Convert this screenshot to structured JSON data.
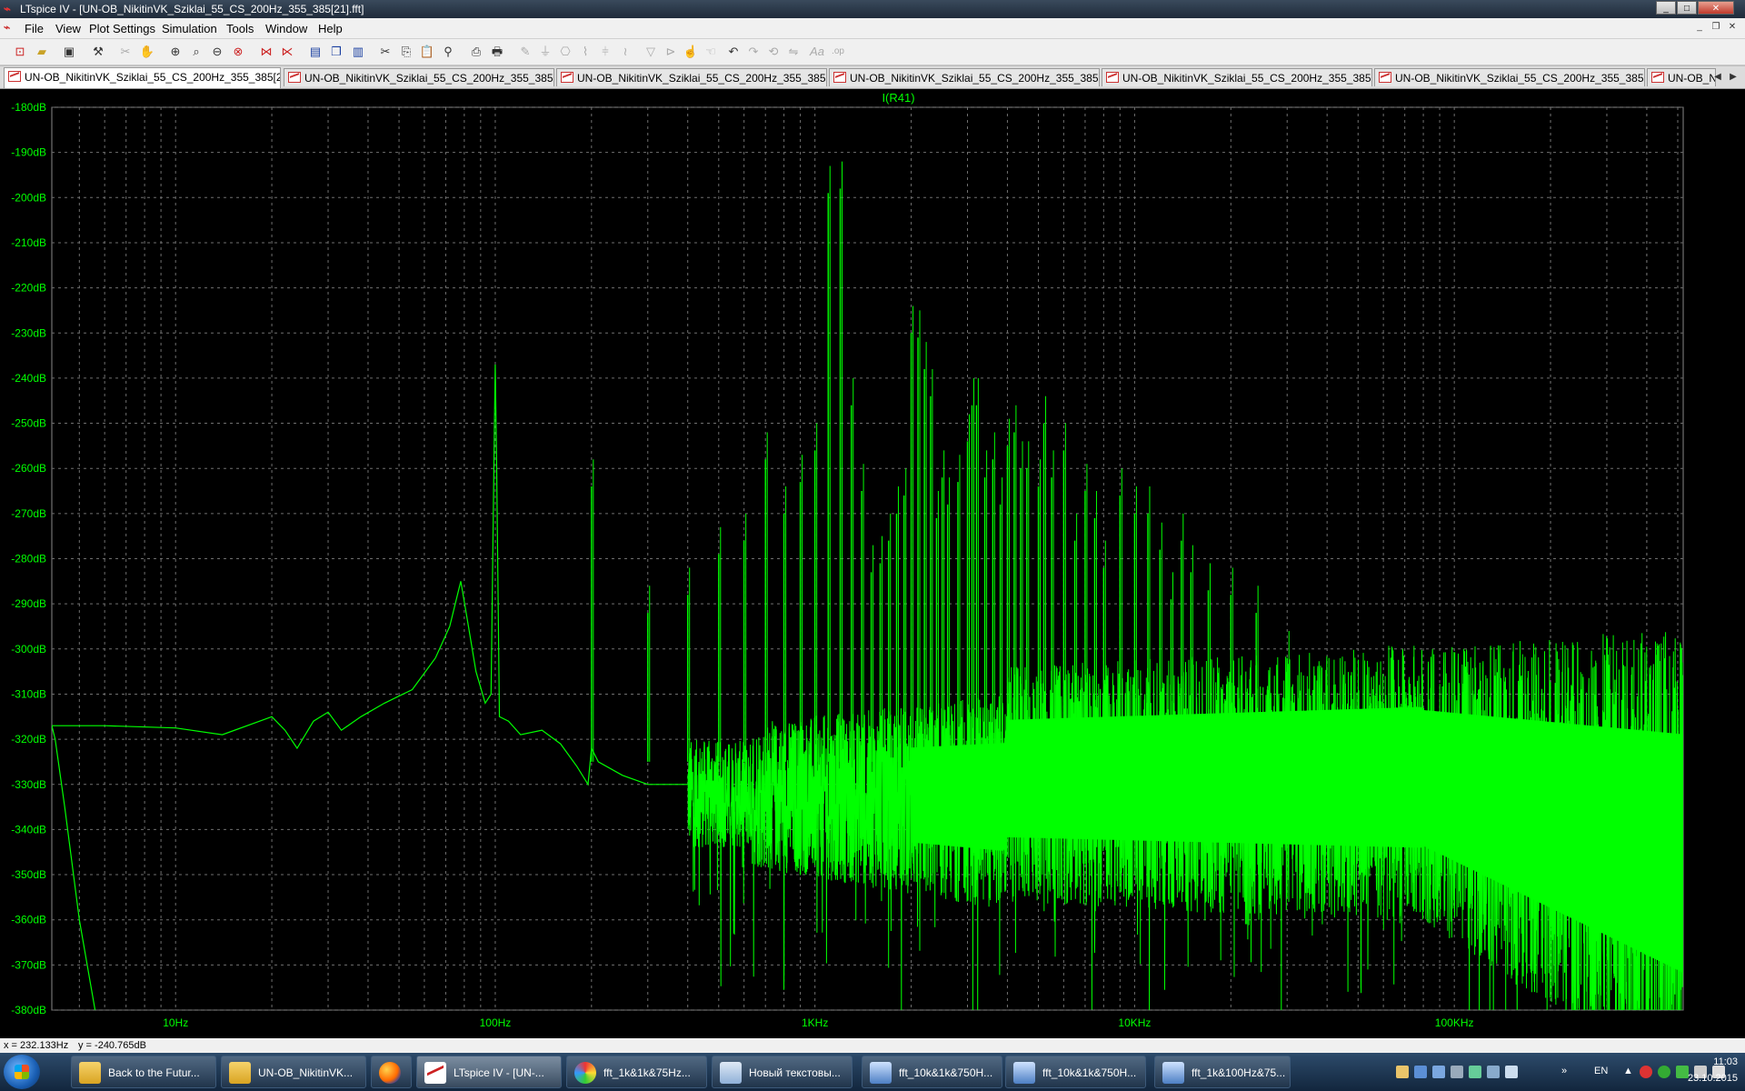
{
  "window": {
    "title": "LTspice IV - [UN-OB_NikitinVK_Sziklai_55_CS_200Hz_355_385[21].fft]",
    "controls": [
      "_",
      "□",
      "✕"
    ]
  },
  "menu": {
    "items": [
      "File",
      "View",
      "Plot Settings",
      "Simulation",
      "Tools",
      "Window",
      "Help"
    ]
  },
  "toolbar": {
    "buttons": [
      "new-schematic",
      "open",
      "save",
      "control-panel",
      "cut-dim",
      "pan-dim",
      "zoom-in",
      "zoom-area",
      "zoom-out",
      "zoom-fit",
      "autorange",
      "mark-unconnected",
      "tile-horizontal",
      "cascade",
      "tile-vertical",
      "cut",
      "copy",
      "paste",
      "find",
      "print-preview",
      "print",
      "wire",
      "ground",
      "label",
      "resistor",
      "capacitor",
      "inductor",
      "diode",
      "component",
      "move",
      "drag",
      "undo",
      "redo",
      "rotate",
      "mirror",
      "text",
      "spice-directive"
    ]
  },
  "tabs": [
    {
      "label": "UN-OB_NikitinVK_Sziklai_55_CS_200Hz_355_385[21].fft",
      "active": true
    },
    {
      "label": "UN-OB_NikitinVK_Sziklai_55_CS_200Hz_355_385[2].fft",
      "active": false
    },
    {
      "label": "UN-OB_NikitinVK_Sziklai_55_CS_200Hz_355_385[3].fft",
      "active": false
    },
    {
      "label": "UN-OB_NikitinVK_Sziklai_55_CS_200Hz_355_385[4].fft",
      "active": false
    },
    {
      "label": "UN-OB_NikitinVK_Sziklai_55_CS_200Hz_355_385[5].fft",
      "active": false
    },
    {
      "label": "UN-OB_NikitinVK_Sziklai_55_CS_200Hz_355_385[6].fft",
      "active": false
    },
    {
      "label": "UN-OB_N",
      "active": false
    }
  ],
  "chart_data": {
    "type": "line",
    "title": "I(R41)",
    "series": [
      {
        "name": "I(R41)",
        "color": "#00ff00"
      }
    ],
    "xscale": "log",
    "xlim": [
      4.1,
      520000
    ],
    "ylim": [
      -380,
      -180
    ],
    "xlabel": "",
    "ylabel": "",
    "xticks": [
      {
        "value": 10,
        "label": "10Hz"
      },
      {
        "value": 100,
        "label": "100Hz"
      },
      {
        "value": 1000,
        "label": "1KHz"
      },
      {
        "value": 10000,
        "label": "10KHz"
      },
      {
        "value": 100000,
        "label": "100KHz"
      }
    ],
    "yticks": [
      {
        "value": -180,
        "label": "-180dB"
      },
      {
        "value": -190,
        "label": "-190dB"
      },
      {
        "value": -200,
        "label": "-200dB"
      },
      {
        "value": -210,
        "label": "-210dB"
      },
      {
        "value": -220,
        "label": "-220dB"
      },
      {
        "value": -230,
        "label": "-230dB"
      },
      {
        "value": -240,
        "label": "-240dB"
      },
      {
        "value": -250,
        "label": "-250dB"
      },
      {
        "value": -260,
        "label": "-260dB"
      },
      {
        "value": -270,
        "label": "-270dB"
      },
      {
        "value": -280,
        "label": "-280dB"
      },
      {
        "value": -290,
        "label": "-290dB"
      },
      {
        "value": -300,
        "label": "-300dB"
      },
      {
        "value": -310,
        "label": "-310dB"
      },
      {
        "value": -320,
        "label": "-320dB"
      },
      {
        "value": -330,
        "label": "-330dB"
      },
      {
        "value": -340,
        "label": "-340dB"
      },
      {
        "value": -350,
        "label": "-350dB"
      },
      {
        "value": -360,
        "label": "-360dB"
      },
      {
        "value": -370,
        "label": "-370dB"
      },
      {
        "value": -380,
        "label": "-380dB"
      }
    ],
    "grid": true,
    "background": "#000000",
    "low_freq_trace": [
      [
        4.1,
        -317
      ],
      [
        4.2,
        -320
      ],
      [
        4.5,
        -335
      ],
      [
        5.0,
        -360
      ],
      [
        5.6,
        -380
      ]
    ],
    "main_trace": [
      [
        4.1,
        -317
      ],
      [
        6,
        -317
      ],
      [
        10,
        -317.5
      ],
      [
        14,
        -319
      ],
      [
        20,
        -315
      ],
      [
        22,
        -318
      ],
      [
        24,
        -322
      ],
      [
        27,
        -316
      ],
      [
        30,
        -314
      ],
      [
        33,
        -318
      ],
      [
        38,
        -315
      ],
      [
        45,
        -312
      ],
      [
        55,
        -309
      ],
      [
        65,
        -302
      ],
      [
        72,
        -295
      ],
      [
        78,
        -285
      ],
      [
        82,
        -294
      ],
      [
        87,
        -305
      ],
      [
        93,
        -312
      ],
      [
        97,
        -310
      ],
      [
        99,
        -260
      ],
      [
        100,
        -237
      ],
      [
        101,
        -260
      ],
      [
        103,
        -315
      ],
      [
        110,
        -316
      ],
      [
        120,
        -319
      ],
      [
        140,
        -318
      ],
      [
        160,
        -321
      ],
      [
        180,
        -326
      ],
      [
        195,
        -330
      ],
      [
        200,
        -322
      ],
      [
        210,
        -325
      ],
      [
        250,
        -328
      ],
      [
        300,
        -330
      ],
      [
        400,
        -330
      ]
    ],
    "harmonics": [
      [
        200,
        -264
      ],
      [
        300,
        -292
      ],
      [
        400,
        -288
      ],
      [
        500,
        -279
      ],
      [
        600,
        -276
      ],
      [
        700,
        -258
      ],
      [
        800,
        -270
      ],
      [
        900,
        -263
      ],
      [
        1000,
        -256
      ],
      [
        1100,
        -199
      ],
      [
        1200,
        -198
      ],
      [
        1300,
        -246
      ],
      [
        1400,
        -265
      ],
      [
        1500,
        -283
      ],
      [
        1600,
        -281
      ],
      [
        1700,
        -276
      ],
      [
        1800,
        -270
      ],
      [
        1900,
        -266
      ],
      [
        2000,
        -230
      ],
      [
        2100,
        -231
      ],
      [
        2200,
        -238
      ],
      [
        2300,
        -244
      ],
      [
        2400,
        -271
      ],
      [
        2500,
        -262
      ],
      [
        2600,
        -268
      ],
      [
        2800,
        -263
      ],
      [
        3000,
        -254
      ],
      [
        3100,
        -246
      ],
      [
        3200,
        -246
      ],
      [
        3400,
        -262
      ],
      [
        3600,
        -258
      ],
      [
        3800,
        -268
      ],
      [
        4000,
        -255
      ],
      [
        4200,
        -252
      ],
      [
        4400,
        -260
      ],
      [
        4600,
        -260
      ],
      [
        5000,
        -264
      ],
      [
        5200,
        -250
      ],
      [
        5500,
        -262
      ],
      [
        6000,
        -256
      ],
      [
        6500,
        -276
      ],
      [
        7000,
        -265
      ],
      [
        7500,
        -271
      ],
      [
        8000,
        -282
      ],
      [
        9000,
        -266
      ],
      [
        10000,
        -270
      ],
      [
        11000,
        -270
      ],
      [
        12000,
        -278
      ],
      [
        13000,
        -289
      ],
      [
        14000,
        -276
      ],
      [
        15000,
        -283
      ],
      [
        17000,
        -287
      ],
      [
        20000,
        -288
      ],
      [
        24000,
        -292
      ],
      [
        30000,
        -302
      ],
      [
        40000,
        -308
      ],
      [
        60000,
        -312
      ],
      [
        360000,
        -304
      ]
    ]
  },
  "status": {
    "x_readout": "x = 232.133Hz",
    "y_readout": "y = -240.765dB"
  },
  "taskbar": {
    "buttons": [
      {
        "label": "Back to the Futur...",
        "icon": "folder-icon",
        "active": false
      },
      {
        "label": "UN-OB_NikitinVK...",
        "icon": "folder-icon",
        "active": false
      },
      {
        "label": "",
        "icon": "firefox-icon",
        "active": false
      },
      {
        "label": "LTspice IV - [UN-...",
        "icon": "ltspice-icon",
        "active": true
      },
      {
        "label": "fft_1k&1k&75Hz...",
        "icon": "paint-icon",
        "active": false
      },
      {
        "label": "Новый текстовы...",
        "icon": "notepad-icon",
        "active": false
      },
      {
        "label": "fft_10k&1k&750H...",
        "icon": "image-icon",
        "active": false
      },
      {
        "label": "fft_10k&1k&750H...",
        "icon": "image-icon",
        "active": false
      },
      {
        "label": "fft_1k&100Hz&75...",
        "icon": "image-icon",
        "active": false
      }
    ],
    "lang": "EN",
    "time": "11:03",
    "date": "23.10.2015"
  }
}
